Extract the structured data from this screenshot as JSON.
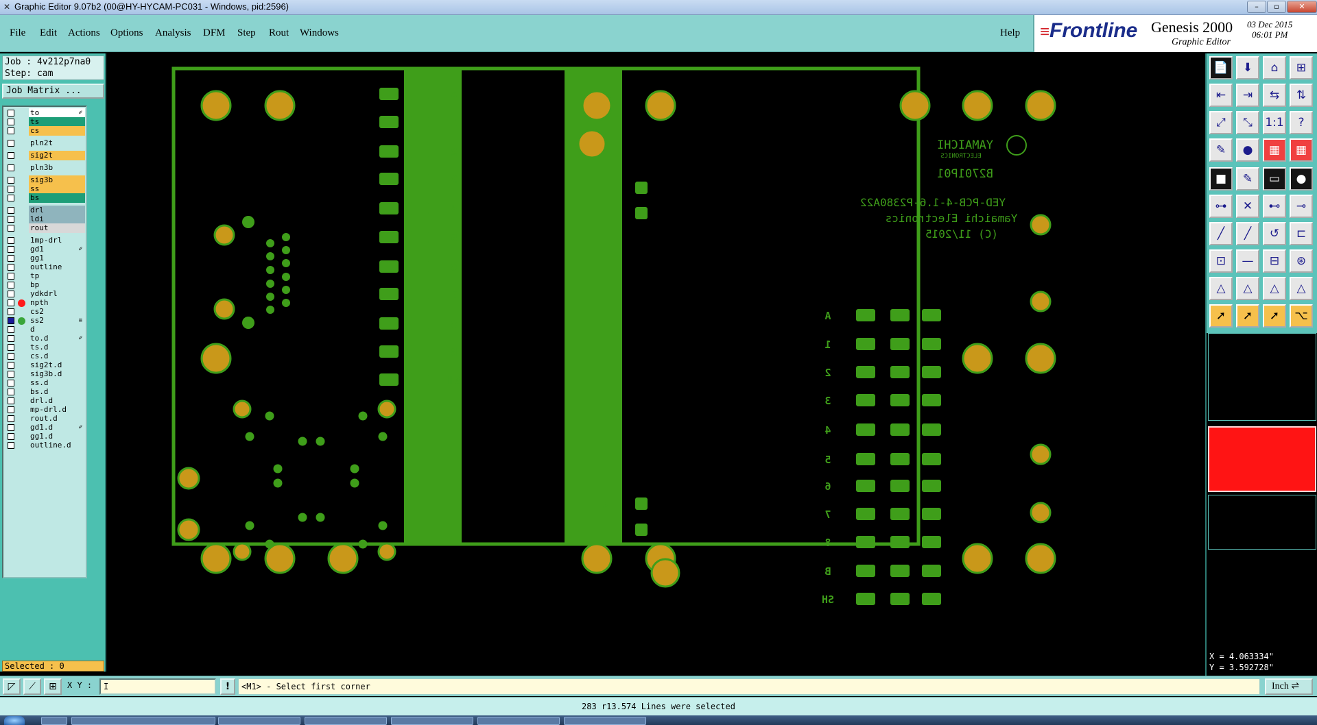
{
  "window": {
    "title": "Graphic Editor 9.07b2 (00@HY-HYCAM-PC031 - Windows, pid:2596)",
    "controls": [
      "–",
      "▫",
      "✕"
    ]
  },
  "menu": [
    "File",
    "Edit",
    "Actions",
    "Options",
    "Analysis",
    "DFM",
    "Step",
    "Rout",
    "Windows"
  ],
  "help_label": "Help",
  "brand": {
    "logo": "Frontline",
    "product": "Genesis 2000",
    "subtitle": "Graphic Editor",
    "date": "03 Dec 2015",
    "time": "06:01 PM"
  },
  "job": {
    "job_line": "Job : 4v212p7na0",
    "step_line": "Step: cam",
    "matrix_button": "Job Matrix ..."
  },
  "layers": [
    {
      "name": "to",
      "color": "#ffffff",
      "mark": "✐"
    },
    {
      "name": "ts",
      "color": "#1d9e78"
    },
    {
      "name": "cs",
      "color": "#f6c04c"
    },
    {
      "name": "pln2t",
      "color": "#bfe8e4",
      "gap": true
    },
    {
      "name": "sig2t",
      "color": "#f6c04c",
      "gap": true
    },
    {
      "name": "pln3b",
      "color": "#bfe8e4",
      "gap": true
    },
    {
      "name": "sig3b",
      "color": "#f6c04c",
      "gap": true
    },
    {
      "name": "ss",
      "color": "#f6c04c"
    },
    {
      "name": "bs",
      "color": "#1d9e78"
    },
    {
      "name": "drl",
      "color": "#8fb4bd",
      "gap": true
    },
    {
      "name": "ldi",
      "color": "#8fb4bd"
    },
    {
      "name": "rout",
      "color": "#d8d8d8"
    },
    {
      "name": "1mp-drl",
      "color": "#bfe8e4",
      "gap": true
    },
    {
      "name": "gd1",
      "color": "#bfe8e4",
      "mark": "✐"
    },
    {
      "name": "gg1",
      "color": "#bfe8e4"
    },
    {
      "name": "outline",
      "color": "#bfe8e4"
    },
    {
      "name": "tp",
      "color": "#bfe8e4"
    },
    {
      "name": "bp",
      "color": "#bfe8e4"
    },
    {
      "name": "ydkdrl",
      "color": "#bfe8e4"
    },
    {
      "name": "npth",
      "color": "#bfe8e4",
      "dot": "#ff1a1a"
    },
    {
      "name": "cs2",
      "color": "#bfe8e4"
    },
    {
      "name": "ss2",
      "color": "#bfe8e4",
      "dot": "#3aa63a",
      "mark": "≡",
      "active": true
    },
    {
      "name": "d",
      "color": "#bfe8e4"
    },
    {
      "name": "to.d",
      "color": "#bfe8e4",
      "mark": "✐"
    },
    {
      "name": "ts.d",
      "color": "#bfe8e4"
    },
    {
      "name": "cs.d",
      "color": "#bfe8e4"
    },
    {
      "name": "sig2t.d",
      "color": "#bfe8e4"
    },
    {
      "name": "sig3b.d",
      "color": "#bfe8e4"
    },
    {
      "name": "ss.d",
      "color": "#bfe8e4"
    },
    {
      "name": "bs.d",
      "color": "#bfe8e4"
    },
    {
      "name": "drl.d",
      "color": "#bfe8e4"
    },
    {
      "name": "mp-drl.d",
      "color": "#bfe8e4"
    },
    {
      "name": "rout.d",
      "color": "#bfe8e4"
    },
    {
      "name": "gd1.d",
      "color": "#bfe8e4",
      "mark": "✐"
    },
    {
      "name": "gg1.d",
      "color": "#bfe8e4"
    },
    {
      "name": "outline.d",
      "color": "#bfe8e4"
    }
  ],
  "selected_count": "Selected : 0",
  "board": {
    "left_row_labels": [
      "A",
      "1",
      "2",
      "3",
      "4",
      "5",
      "6",
      "7",
      "8",
      "B",
      "SH"
    ],
    "right_row_labels": [
      "A",
      "1",
      "2",
      "3",
      "4",
      "5",
      "6",
      "7",
      "8",
      "B",
      "SH"
    ],
    "logo_text": "YAMAICHI",
    "logo_sub": "ELECTRONICS",
    "part_no": "B2701P01",
    "text_lines": [
      "YED-PCB-4-1.6-P2380A22",
      "Yamaichi Electronics",
      "(C) 11/2015"
    ],
    "mid_label": "4",
    "colors": {
      "trace": "#3f9e1a",
      "pad": "#c9981a",
      "ring": "#3f9e1a",
      "bg": "#000000"
    }
  },
  "coords": {
    "x": "X = 4.063334\"",
    "y": "Y = 3.592728\""
  },
  "statusbar": {
    "xy_label": "X Y :",
    "xy_value": "I",
    "prompt": "<M1> - Select first corner",
    "unit": "Inch"
  },
  "message": "283 r13.574 Lines were selected"
}
